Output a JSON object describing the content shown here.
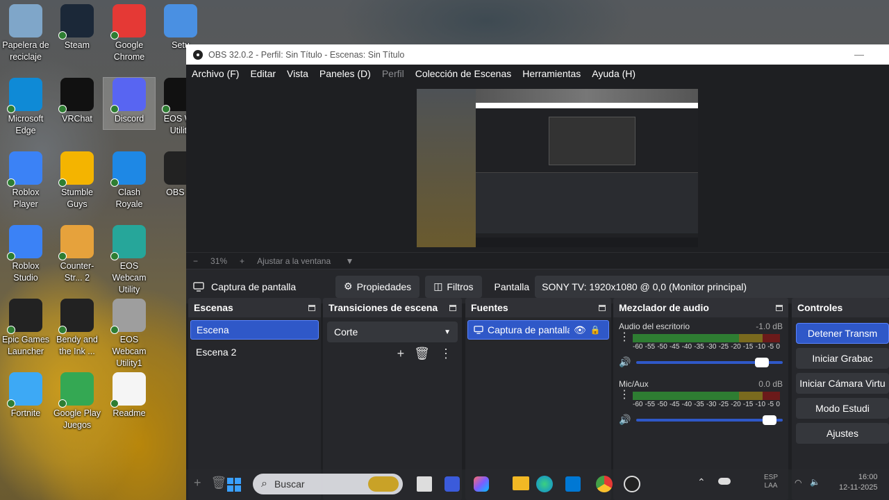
{
  "desktop": {
    "icons": [
      {
        "label": "Papelera de reciclaje",
        "icon": "recycle-bin-icon",
        "color": "#7fa6c9"
      },
      {
        "label": "Steam",
        "icon": "steam-icon",
        "color": "#1b2838"
      },
      {
        "label": "Google Chrome",
        "icon": "chrome-icon",
        "color": "#e53935"
      },
      {
        "label": "Setu",
        "icon": "setup-icon",
        "color": "#4a90e2"
      },
      {
        "label": "Microsoft Edge",
        "icon": "edge-icon",
        "color": "#0f8ad6"
      },
      {
        "label": "VRChat",
        "icon": "vrchat-icon",
        "color": "#111111"
      },
      {
        "label": "Discord",
        "icon": "discord-icon",
        "color": "#5865f2"
      },
      {
        "label": "EOS We Utility",
        "icon": "eos-webcam-icon",
        "color": "#111111"
      },
      {
        "label": "Roblox Player",
        "icon": "roblox-icon",
        "color": "#3b82f6"
      },
      {
        "label": "Stumble Guys",
        "icon": "stumble-guys-icon",
        "color": "#f4b400"
      },
      {
        "label": "Clash Royale",
        "icon": "clash-royale-icon",
        "color": "#1e88e5"
      },
      {
        "label": "OBS St",
        "icon": "obs-icon",
        "color": "#222222"
      },
      {
        "label": "Roblox Studio",
        "icon": "roblox-studio-icon",
        "color": "#3b82f6"
      },
      {
        "label": "Counter-Str... 2",
        "icon": "counter-strike-icon",
        "color": "#e6a23c"
      },
      {
        "label": "EOS Webcam Utility",
        "icon": "eos-webcam-utility-icon",
        "color": "#26a69a"
      },
      {
        "label": "Epic Games Launcher",
        "icon": "epic-games-icon",
        "color": "#222222"
      },
      {
        "label": "Bendy and the Ink ...",
        "icon": "bendy-icon",
        "color": "#222222"
      },
      {
        "label": "EOS Webcam Utility1",
        "icon": "eos-webcam-utility1-icon",
        "color": "#9e9e9e"
      },
      {
        "label": "Fortnite",
        "icon": "fortnite-icon",
        "color": "#3da9f5"
      },
      {
        "label": "Google Play Juegos",
        "icon": "google-play-games-icon",
        "color": "#34a853"
      },
      {
        "label": "Readme",
        "icon": "readme-icon",
        "color": "#f5f5f5"
      }
    ]
  },
  "obs": {
    "title": "OBS 32.0.2 - Perfil: Sin Título - Escenas: Sin Título",
    "menu": [
      "Archivo (F)",
      "Editar",
      "Vista",
      "Paneles (D)",
      "Perfil",
      "Colección de Escenas",
      "Herramientas",
      "Ayuda (H)"
    ],
    "zoom": {
      "minus": "−",
      "percent": "31%",
      "plus": "+",
      "fit": "Ajustar a la ventana"
    },
    "source_bar": {
      "source": "Captura de pantalla",
      "properties": "Propiedades",
      "filters": "Filtros",
      "display_label": "Pantalla",
      "display_value": "SONY TV: 1920x1080 @ 0,0 (Monitor principal)"
    },
    "scenes": {
      "title": "Escenas",
      "items": [
        "Escena",
        "Escena 2"
      ]
    },
    "transitions": {
      "title": "Transiciones de escena",
      "selected": "Corte"
    },
    "sources": {
      "title": "Fuentes",
      "items": [
        "Captura de pantalla"
      ]
    },
    "mixer": {
      "title": "Mezclador de audio",
      "channels": [
        {
          "name": "Audio del escritorio",
          "db": "-1.0 dB",
          "volume": 0.9
        },
        {
          "name": "Mic/Aux",
          "db": "0.0 dB",
          "volume": 0.95
        }
      ],
      "scale": [
        "-60",
        "-55",
        "-50",
        "-45",
        "-40",
        "-35",
        "-30",
        "-25",
        "-20",
        "-15",
        "-10",
        "-5",
        "0"
      ]
    },
    "controls": {
      "title": "Controles",
      "buttons": [
        "Detener Transm",
        "Iniciar Grabac",
        "Iniciar Cámara Virtu",
        "Modo Estudi",
        "Ajustes"
      ]
    }
  },
  "taskbar": {
    "search_placeholder": "Buscar",
    "lang": "ESP",
    "lang2": "LAA",
    "time": "16:00",
    "date": "12-11-2025"
  }
}
